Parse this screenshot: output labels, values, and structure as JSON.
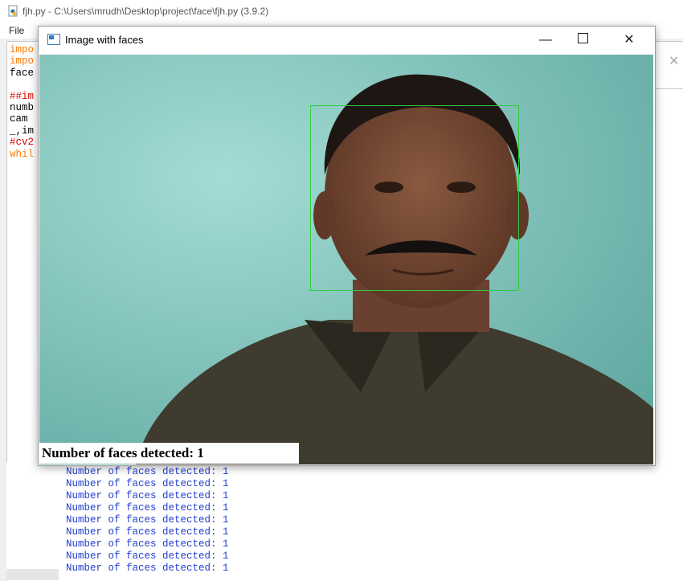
{
  "idle": {
    "title": "fjh.py - C:\\Users\\mrudh\\Desktop\\project\\face\\fjh.py (3.9.2)",
    "menu_file": "File",
    "code_lines": [
      {
        "text": "impo",
        "cls": "c-orange"
      },
      {
        "text": "impo",
        "cls": "c-orange"
      },
      {
        "text": "face",
        "cls": "c-black"
      },
      {
        "text": "",
        "cls": "c-black"
      },
      {
        "text": "##im",
        "cls": "c-red"
      },
      {
        "text": "numb",
        "cls": "c-black"
      },
      {
        "text": "cam",
        "cls": "c-black"
      },
      {
        "text": "_,im",
        "cls": "c-black"
      },
      {
        "text": "#cv2",
        "cls": "c-red"
      },
      {
        "text": "whil",
        "cls": "c-orange"
      }
    ]
  },
  "cv_window": {
    "title": "Image with faces",
    "minimize": "—",
    "close": "✕",
    "caption": "Number of faces detected: 1"
  },
  "shell_output": [
    "Number of faces detected: 1",
    "Number of faces detected: 1",
    "Number of faces detected: 1",
    "Number of faces detected: 1",
    "Number of faces detected: 1",
    "Number of faces detected: 1",
    "Number of faces detected: 1",
    "Number of faces detected: 1",
    "Number of faces detected: 1"
  ],
  "colors": {
    "detection_box": "#2ecc40",
    "output_text": "#1f3fd0",
    "keyword": "#ff7700",
    "comment": "#dd0000"
  }
}
